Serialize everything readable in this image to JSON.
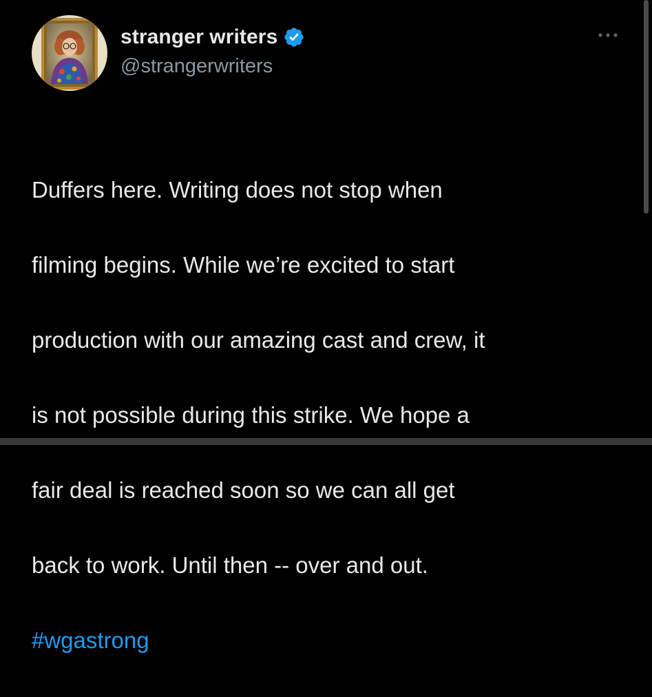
{
  "tweet": {
    "author": {
      "display_name": "stranger writers",
      "handle": "@strangerwriters",
      "verified": true,
      "verified_icon": "verified-badge-icon"
    },
    "more_icon": "more-options-icon",
    "text_lines": [
      "Duffers here. Writing does not stop when",
      "filming begins. While we’re excited to start",
      "production with our amazing cast and crew, it",
      "is not possible during this strike. We hope a",
      "fair deal is reached soon so we can all get",
      "back to work. Until then -- over and out."
    ],
    "hashtag": "#wgastrong"
  },
  "colors": {
    "background": "#000000",
    "text": "#e7e9ea",
    "secondary_text": "#8b98a5",
    "link": "#1d9bf0",
    "verified": "#1d9bf0"
  }
}
